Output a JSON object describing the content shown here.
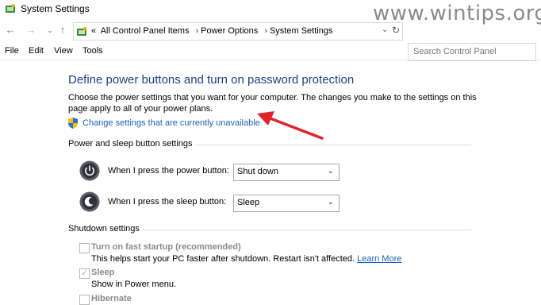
{
  "window": {
    "title": "System Settings"
  },
  "watermark": "www.wintips.org",
  "address": {
    "crumbs": [
      "All Control Panel Items",
      "Power Options",
      "System Settings"
    ],
    "overflow": "«"
  },
  "search": {
    "placeholder": "Search Control Panel"
  },
  "menu": {
    "file": "File",
    "edit": "Edit",
    "view": "View",
    "tools": "Tools"
  },
  "main": {
    "heading": "Define power buttons and turn on password protection",
    "description": "Choose the power settings that you want for your computer. The changes you make to the settings on this page apply to all of your power plans.",
    "change_link": "Change settings that are currently unavailable"
  },
  "power_sleep": {
    "group_title": "Power and sleep button settings",
    "power_label": "When I press the power button:",
    "power_value": "Shut down",
    "sleep_label": "When I press the sleep button:",
    "sleep_value": "Sleep"
  },
  "shutdown": {
    "group_title": "Shutdown settings",
    "fast_startup": {
      "label": "Turn on fast startup (recommended)",
      "checked": false,
      "desc": "This helps start your PC faster after shutdown. Restart isn't affected.",
      "learn_more": "Learn More"
    },
    "sleep": {
      "label": "Sleep",
      "checked": true,
      "desc": "Show in Power menu."
    },
    "hibernate": {
      "label": "Hibernate",
      "checked": false
    }
  },
  "colors": {
    "heading": "#1e3f8a",
    "link": "#1c62b9",
    "annotation_arrow": "#e0242b"
  }
}
